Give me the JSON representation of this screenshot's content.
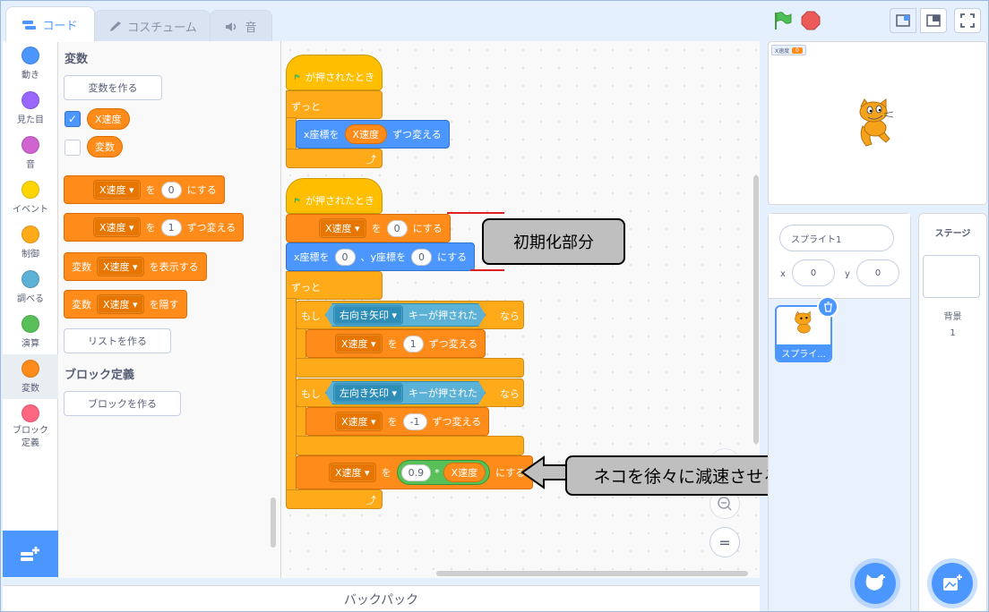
{
  "tabs": [
    {
      "label": "コード",
      "icon": "code-icon"
    },
    {
      "label": "コスチューム",
      "icon": "brush-icon"
    },
    {
      "label": "音",
      "icon": "speaker-icon"
    }
  ],
  "categories": [
    {
      "label": "動き",
      "color": "#4c97ff"
    },
    {
      "label": "見た目",
      "color": "#9966ff"
    },
    {
      "label": "音",
      "color": "#cf63cf"
    },
    {
      "label": "イベント",
      "color": "#ffd500"
    },
    {
      "label": "制御",
      "color": "#ffab19"
    },
    {
      "label": "調べる",
      "color": "#5cb1d6"
    },
    {
      "label": "演算",
      "color": "#59c059"
    },
    {
      "label": "変数",
      "color": "#ff8c1a"
    },
    {
      "label": "ブロック定義",
      "color": "#ff6680"
    }
  ],
  "palette": {
    "heading_variables": "変数",
    "make_variable": "変数を作る",
    "var1": "X速度",
    "var2": "変数",
    "set_block": {
      "var": "X速度",
      "to": "を",
      "value": "0",
      "suffix": "にする"
    },
    "change_block": {
      "var": "X速度",
      "to": "を",
      "value": "1",
      "suffix": "ずつ変える"
    },
    "show_block": {
      "prefix": "変数",
      "var": "X速度",
      "suffix": "を表示する"
    },
    "hide_block": {
      "prefix": "変数",
      "var": "X速度",
      "suffix": "を隠す"
    },
    "make_list": "リストを作る",
    "heading_myblocks": "ブロック定義",
    "make_block": "ブロックを作る"
  },
  "script1": {
    "hat": "が押されたとき",
    "forever": "ずっと",
    "change_x": "x座標を",
    "var": "X速度",
    "change_x_suffix": "ずつ変える"
  },
  "script2": {
    "hat": "が押されたとき",
    "set_var": "X速度",
    "set_to": "を",
    "set_value": "0",
    "set_suffix": "にする",
    "goto_x_label": "x座標を",
    "goto_x": "0",
    "goto_sep": "、y座標を",
    "goto_y": "0",
    "goto_suffix": "にする",
    "forever": "ずっと",
    "if1": "もし",
    "key1": "右向き矢印",
    "key_pressed": "キーが押された",
    "then": "なら",
    "change1_var": "X速度",
    "change1_to": "を",
    "change1_value": "1",
    "change1_suffix": "ずつ変える",
    "if2": "もし",
    "key2": "左向き矢印",
    "change2_var": "X速度",
    "change2_to": "を",
    "change2_value": "-1",
    "change2_suffix": "ずつ変える",
    "set2_var": "X速度",
    "set2_to": "を",
    "mult_value": "0.9",
    "mult_op": "*",
    "mult_var": "X速度",
    "set2_suffix": "にする"
  },
  "callouts": {
    "init": "初期化部分",
    "decel": "ネコを徐々に減速させるプログラム"
  },
  "backpack": "バックパック",
  "stage": {
    "monitor_label": "X速度",
    "monitor_value": "0"
  },
  "sprite_info": {
    "name": "スプライト1",
    "x_label": "x",
    "x_value": "0",
    "y_label": "y",
    "y_value": "0"
  },
  "sprite_thumb_name": "スプライ...",
  "stage_pane": {
    "title": "ステージ",
    "backdrops_label": "背景",
    "backdrops_count": "1"
  },
  "colors": {
    "accent": "#4c97ff",
    "variables": "#ff8c1a",
    "control": "#ffab19",
    "events": "#ffbf00",
    "operators": "#59c059",
    "sensing": "#5cb1d6",
    "callout_line": "#e02020"
  }
}
